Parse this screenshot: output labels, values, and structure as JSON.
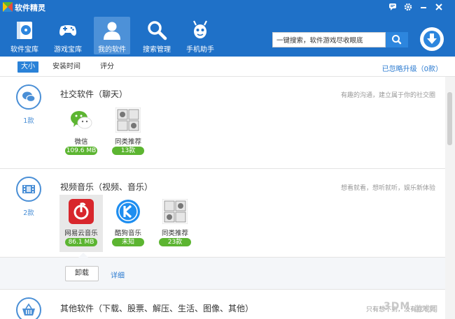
{
  "app": {
    "title": "软件精灵"
  },
  "colors": {
    "header": "#1f71c8",
    "accent": "#2a82d8",
    "badge": "#5cb531"
  },
  "nav": [
    {
      "label": "软件宝库",
      "icon": "disc-box-icon"
    },
    {
      "label": "游戏宝库",
      "icon": "gamepad-icon"
    },
    {
      "label": "我的软件",
      "icon": "user-icon",
      "active": true
    },
    {
      "label": "搜索管理",
      "icon": "magnifier-icon"
    },
    {
      "label": "手机助手",
      "icon": "robot-icon"
    }
  ],
  "search": {
    "value": "一键搜索，软件游戏尽收眼底"
  },
  "toolbar": {
    "tabs": [
      "大小",
      "安装时间",
      "评分"
    ],
    "active_tab": "大小",
    "ignored": "已忽略升级（0款）"
  },
  "categories": [
    {
      "title": "社交软件（聊天）",
      "count": "1款",
      "desc": "有趣的沟通，建立属于你的社交圈",
      "apps": [
        {
          "name": "微信",
          "badge": "109.6 MB",
          "icon": "wechat-icon"
        },
        {
          "name": "同类推荐",
          "badge": "13款",
          "icon": "similar-grid-icon"
        }
      ]
    },
    {
      "title": "视频音乐（视频、音乐）",
      "count": "2款",
      "desc": "想看就看，想听就听，娱乐新体验",
      "apps": [
        {
          "name": "网易云音乐",
          "badge": "86.1 MB",
          "icon": "netease-music-icon"
        },
        {
          "name": "酷狗音乐",
          "badge": "未知",
          "icon": "kugou-icon"
        },
        {
          "name": "同类推荐",
          "badge": "23款",
          "icon": "similar-grid-icon"
        }
      ]
    },
    {
      "title": "其他软件（下载、股票、解压、生活、图像、其他）",
      "desc": "只有想不到，没有找不到"
    }
  ],
  "detail": {
    "uninstall": "卸载",
    "details": "详细"
  },
  "watermark": {
    "text": "3DM",
    "text2": "游戏网"
  }
}
